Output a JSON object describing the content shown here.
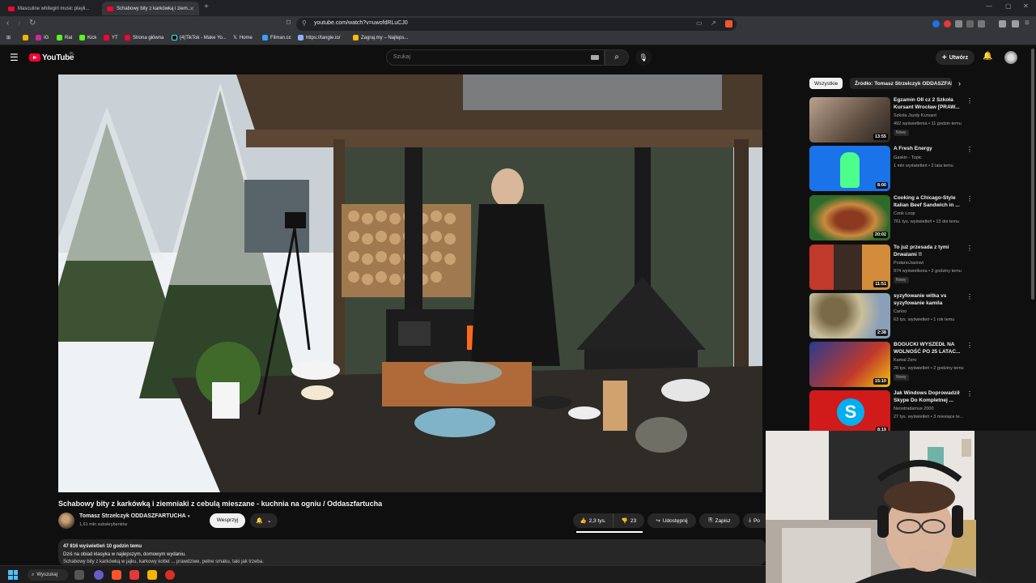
{
  "browser": {
    "tabs": [
      {
        "title": "Masculine whitegirl music playli..."
      },
      {
        "title": "Schabowy bity z karkówką i ziem..."
      }
    ],
    "url": "youtube.com/watch?v=uwofdRLuCJ0",
    "bookmarks": [
      "IG",
      "Rat",
      "Kick",
      "YT",
      "Strona główna",
      "(4)TikTok - Make Yo...",
      "Home",
      "Filman.cc",
      "https://tangle.io/",
      "Zagraj.my – Najleps..."
    ]
  },
  "header": {
    "brand": "YouTube",
    "region": "PL",
    "search_placeholder": "Szukaj",
    "create_label": "Utwórz"
  },
  "video": {
    "title": "Schabowy bity z karkówką i ziemniaki z cebulą mieszane - kuchnia na ogniu / Oddaszfartucha",
    "channel": "Tomasz Strzelczyk ODDASZFARTUCHA",
    "subscribers": "1,61 mln subskrybentów",
    "support_label": "Wesprzyj",
    "likes": "2,3 tys.",
    "dislikes": "23",
    "share_label": "Udostępnij",
    "save_label": "Zapisz",
    "more_label": "Po",
    "views_time": "47 816 wyświetleń  10 godzin temu",
    "desc_line1": "Dziś na obiad klasyka w najlepszym, domowym wydaniu.",
    "desc_line2": "Schabowy bity z karkówką w jajku, karkowy kotlet ... prawdziwe, pełne smaku, taki jak trzeba."
  },
  "sidebar": {
    "chips": [
      "Wszystkie",
      "Źródło: Tomasz Strzelczyk ODDASZFARTUCHA"
    ],
    "recommendations": [
      {
        "title": "Egzamin OII cz 2 Szkoła Kursant Wrocław [PRAW...",
        "channel": "Szkoła Jazdy Kursant",
        "meta": "492 wyświetlenia • 11 godzin temu",
        "badge": "Nowy",
        "duration": "13:55"
      },
      {
        "title": "A Fresh Energy",
        "channel": "Gaskin - Topic",
        "meta": "1 mln wyświetleń • 2 lata temu",
        "badge": "",
        "duration": "8:00"
      },
      {
        "title": "Cooking a Chicago-Style Italian Beef Sandwich in ...",
        "channel": "Cook Loop",
        "meta": "761 tys. wyświetleń • 13 dni temu",
        "badge": "",
        "duration": "20:02"
      },
      {
        "title": "To już przesada z tymi Drwalami !!",
        "channel": "PodanoJasiowi",
        "meta": "974 wyświetlenia • 2 godziny temu",
        "badge": "Nowy",
        "duration": "11:51"
      },
      {
        "title": "syzyfowanie witka vs syzyfowanie kamila",
        "channel": "Carloo",
        "meta": "63 tys. wyświetleń • 1 rok temu",
        "badge": "",
        "duration": "2:38"
      },
      {
        "title": "BOGUCKI WYSZEDŁ NA WOLNOŚĆ PO 25 LATAC...",
        "channel": "Kamal Zero",
        "meta": "28 tys. wyświetleń • 2 godziny temu",
        "badge": "Nowy",
        "duration": "15:10"
      },
      {
        "title": "Jak Windows Doprowadził Skype Do Kompletnej ...",
        "channel": "Neostradamus 2000",
        "meta": "27 tys. wyświetleń • 3 miesiące te...",
        "badge": "",
        "duration": "8:19"
      }
    ]
  },
  "taskbar": {
    "search_label": "Wyszukaj"
  }
}
